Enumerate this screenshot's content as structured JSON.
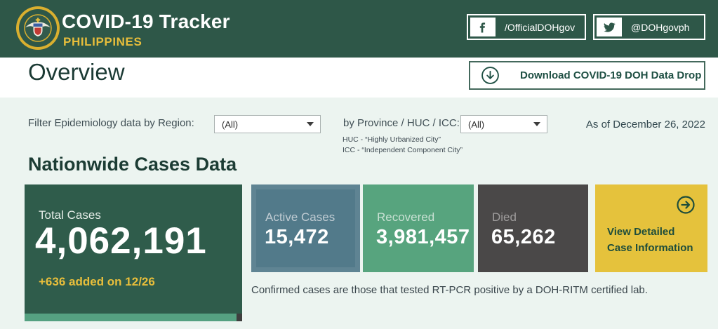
{
  "header": {
    "title": "COVID-19 Tracker",
    "subtitle": "PHILIPPINES",
    "facebook_handle": "/OfficialDOHgov",
    "twitter_handle": "@DOHgovph"
  },
  "overview": {
    "title": "Overview",
    "download_button": "Download COVID-19 DOH Data Drop"
  },
  "filters": {
    "region_label": "Filter Epidemiology data by Region:",
    "region_value": "(All)",
    "province_label": "by Province / HUC / ICC:",
    "province_value": "(All)",
    "huc_note": "HUC - “Highly Urbanized City”",
    "icc_note": "ICC - “Independent Component City”",
    "as_of": "As of December 26, 2022"
  },
  "cases": {
    "section_title": "Nationwide Cases Data",
    "total": {
      "label": "Total Cases",
      "value": "4,062,191",
      "delta": "+636 added on 12/26"
    },
    "active": {
      "label": "Active Cases",
      "value": "15,472"
    },
    "recovered": {
      "label": "Recovered",
      "value": "3,981,457"
    },
    "died": {
      "label": "Died",
      "value": "65,262"
    },
    "detail_button": {
      "line1": "View Detailed",
      "line2": "Case Information"
    },
    "footnote": "Confirmed cases are those that tested RT-PCR positive by a DOH-RITM certified lab."
  },
  "colors": {
    "header_green": "#2E5748",
    "gold": "#E8BE3B",
    "mint_bg": "#ECF4F0",
    "total_card": "#2F5C4B",
    "active_card": "#527A8A",
    "recovered_card": "#57A47E",
    "died_card": "#4A4848",
    "detail_card": "#E5C23C",
    "dark_green_text": "#1E4D3B"
  }
}
